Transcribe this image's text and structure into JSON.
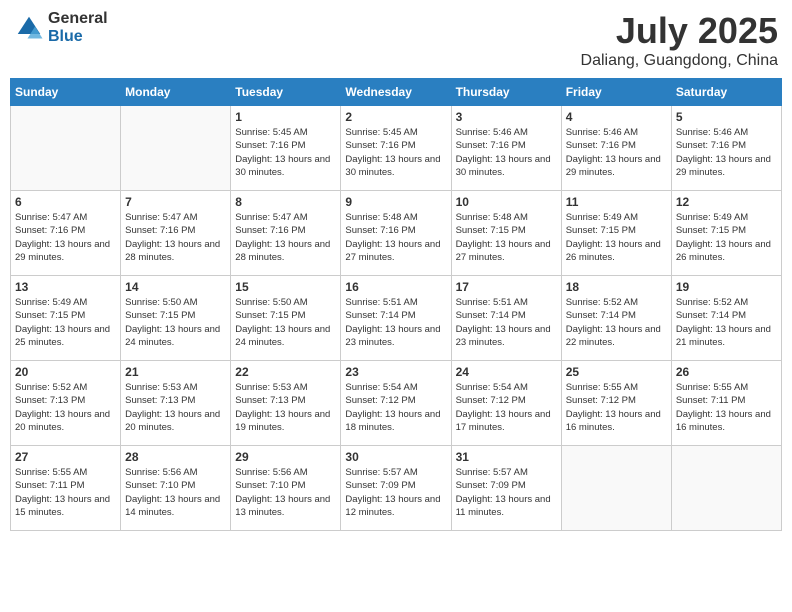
{
  "header": {
    "logo_general": "General",
    "logo_blue": "Blue",
    "month_title": "July 2025",
    "location": "Daliang, Guangdong, China"
  },
  "weekdays": [
    "Sunday",
    "Monday",
    "Tuesday",
    "Wednesday",
    "Thursday",
    "Friday",
    "Saturday"
  ],
  "weeks": [
    [
      {
        "day": "",
        "info": ""
      },
      {
        "day": "",
        "info": ""
      },
      {
        "day": "1",
        "info": "Sunrise: 5:45 AM\nSunset: 7:16 PM\nDaylight: 13 hours and 30 minutes."
      },
      {
        "day": "2",
        "info": "Sunrise: 5:45 AM\nSunset: 7:16 PM\nDaylight: 13 hours and 30 minutes."
      },
      {
        "day": "3",
        "info": "Sunrise: 5:46 AM\nSunset: 7:16 PM\nDaylight: 13 hours and 30 minutes."
      },
      {
        "day": "4",
        "info": "Sunrise: 5:46 AM\nSunset: 7:16 PM\nDaylight: 13 hours and 29 minutes."
      },
      {
        "day": "5",
        "info": "Sunrise: 5:46 AM\nSunset: 7:16 PM\nDaylight: 13 hours and 29 minutes."
      }
    ],
    [
      {
        "day": "6",
        "info": "Sunrise: 5:47 AM\nSunset: 7:16 PM\nDaylight: 13 hours and 29 minutes."
      },
      {
        "day": "7",
        "info": "Sunrise: 5:47 AM\nSunset: 7:16 PM\nDaylight: 13 hours and 28 minutes."
      },
      {
        "day": "8",
        "info": "Sunrise: 5:47 AM\nSunset: 7:16 PM\nDaylight: 13 hours and 28 minutes."
      },
      {
        "day": "9",
        "info": "Sunrise: 5:48 AM\nSunset: 7:16 PM\nDaylight: 13 hours and 27 minutes."
      },
      {
        "day": "10",
        "info": "Sunrise: 5:48 AM\nSunset: 7:15 PM\nDaylight: 13 hours and 27 minutes."
      },
      {
        "day": "11",
        "info": "Sunrise: 5:49 AM\nSunset: 7:15 PM\nDaylight: 13 hours and 26 minutes."
      },
      {
        "day": "12",
        "info": "Sunrise: 5:49 AM\nSunset: 7:15 PM\nDaylight: 13 hours and 26 minutes."
      }
    ],
    [
      {
        "day": "13",
        "info": "Sunrise: 5:49 AM\nSunset: 7:15 PM\nDaylight: 13 hours and 25 minutes."
      },
      {
        "day": "14",
        "info": "Sunrise: 5:50 AM\nSunset: 7:15 PM\nDaylight: 13 hours and 24 minutes."
      },
      {
        "day": "15",
        "info": "Sunrise: 5:50 AM\nSunset: 7:15 PM\nDaylight: 13 hours and 24 minutes."
      },
      {
        "day": "16",
        "info": "Sunrise: 5:51 AM\nSunset: 7:14 PM\nDaylight: 13 hours and 23 minutes."
      },
      {
        "day": "17",
        "info": "Sunrise: 5:51 AM\nSunset: 7:14 PM\nDaylight: 13 hours and 23 minutes."
      },
      {
        "day": "18",
        "info": "Sunrise: 5:52 AM\nSunset: 7:14 PM\nDaylight: 13 hours and 22 minutes."
      },
      {
        "day": "19",
        "info": "Sunrise: 5:52 AM\nSunset: 7:14 PM\nDaylight: 13 hours and 21 minutes."
      }
    ],
    [
      {
        "day": "20",
        "info": "Sunrise: 5:52 AM\nSunset: 7:13 PM\nDaylight: 13 hours and 20 minutes."
      },
      {
        "day": "21",
        "info": "Sunrise: 5:53 AM\nSunset: 7:13 PM\nDaylight: 13 hours and 20 minutes."
      },
      {
        "day": "22",
        "info": "Sunrise: 5:53 AM\nSunset: 7:13 PM\nDaylight: 13 hours and 19 minutes."
      },
      {
        "day": "23",
        "info": "Sunrise: 5:54 AM\nSunset: 7:12 PM\nDaylight: 13 hours and 18 minutes."
      },
      {
        "day": "24",
        "info": "Sunrise: 5:54 AM\nSunset: 7:12 PM\nDaylight: 13 hours and 17 minutes."
      },
      {
        "day": "25",
        "info": "Sunrise: 5:55 AM\nSunset: 7:12 PM\nDaylight: 13 hours and 16 minutes."
      },
      {
        "day": "26",
        "info": "Sunrise: 5:55 AM\nSunset: 7:11 PM\nDaylight: 13 hours and 16 minutes."
      }
    ],
    [
      {
        "day": "27",
        "info": "Sunrise: 5:55 AM\nSunset: 7:11 PM\nDaylight: 13 hours and 15 minutes."
      },
      {
        "day": "28",
        "info": "Sunrise: 5:56 AM\nSunset: 7:10 PM\nDaylight: 13 hours and 14 minutes."
      },
      {
        "day": "29",
        "info": "Sunrise: 5:56 AM\nSunset: 7:10 PM\nDaylight: 13 hours and 13 minutes."
      },
      {
        "day": "30",
        "info": "Sunrise: 5:57 AM\nSunset: 7:09 PM\nDaylight: 13 hours and 12 minutes."
      },
      {
        "day": "31",
        "info": "Sunrise: 5:57 AM\nSunset: 7:09 PM\nDaylight: 13 hours and 11 minutes."
      },
      {
        "day": "",
        "info": ""
      },
      {
        "day": "",
        "info": ""
      }
    ]
  ]
}
